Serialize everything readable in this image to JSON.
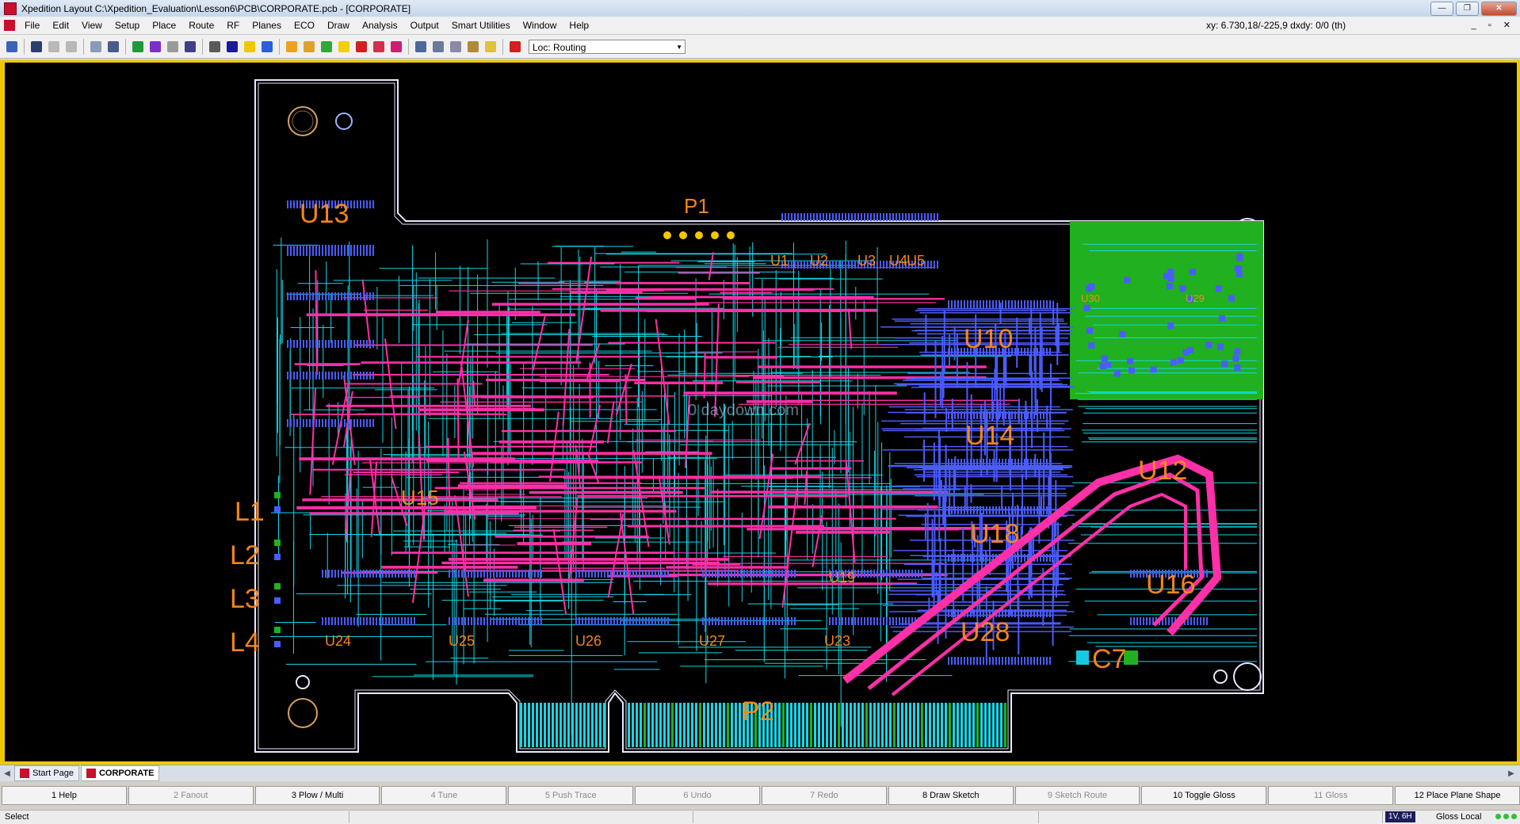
{
  "window": {
    "title": "Xpedition Layout  C:\\Xpedition_Evaluation\\Lesson6\\PCB\\CORPORATE.pcb - [CORPORATE]",
    "buttons": {
      "minimize": "—",
      "restore": "❐",
      "close": "✕"
    }
  },
  "menubar": {
    "items": [
      "File",
      "Edit",
      "View",
      "Setup",
      "Place",
      "Route",
      "RF",
      "Planes",
      "ECO",
      "Draw",
      "Analysis",
      "Output",
      "Smart Utilities",
      "Window",
      "Help"
    ],
    "coordinates": "xy: 6.730,18/-225,9  dxdy: 0/0  (th)",
    "mdi_buttons": "_ ▫ ✕"
  },
  "toolbar": {
    "loc_select": "Loc: Routing",
    "icons": [
      "save-icon",
      "find-icon",
      "undo-icon",
      "redo-icon",
      "place-icon",
      "move-icon",
      "select-area-icon",
      "cross-probe-icon",
      "highlight-icon",
      "mirror-icon",
      "pointer-icon",
      "layer-icon",
      "route-icon",
      "gloss-icon",
      "display-icon",
      "fanout-icon",
      "tune-icon",
      "drc-icon",
      "drc-check-icon",
      "spf-icon",
      "design-check-icon",
      "zoom-icon",
      "zoom-area-icon",
      "zoom-fit-icon",
      "view-icon",
      "netline-icon",
      "grid-icon"
    ]
  },
  "board": {
    "refdes": [
      "P1",
      "P2",
      "U13",
      "U10",
      "U14",
      "U18",
      "U28",
      "U12",
      "U16",
      "L1",
      "L2",
      "L3",
      "L4",
      "U24",
      "U25",
      "U26",
      "U27",
      "U23",
      "U19",
      "U15",
      "U30",
      "U29",
      "C7",
      "U1",
      "U2",
      "U3",
      "U4",
      "U5"
    ],
    "watermark": "0 daydown.com"
  },
  "tabs": {
    "items": [
      "Start Page",
      "CORPORATE"
    ],
    "active": "CORPORATE"
  },
  "fkeys": [
    {
      "label": "1 Help",
      "enabled": true
    },
    {
      "label": "2 Fanout",
      "enabled": false
    },
    {
      "label": "3 Plow / Multi",
      "enabled": true
    },
    {
      "label": "4 Tune",
      "enabled": false
    },
    {
      "label": "5 Push Trace",
      "enabled": false
    },
    {
      "label": "6 Undo",
      "enabled": false
    },
    {
      "label": "7 Redo",
      "enabled": false
    },
    {
      "label": "8 Draw Sketch",
      "enabled": true
    },
    {
      "label": "9 Sketch Route",
      "enabled": false
    },
    {
      "label": "10 Toggle Gloss",
      "enabled": true
    },
    {
      "label": "11 Gloss",
      "enabled": false
    },
    {
      "label": "12 Place Plane Shape",
      "enabled": true
    }
  ],
  "status": {
    "mode": "Select",
    "layer": "1V, 6H",
    "gloss": "Gloss Local"
  },
  "colors": {
    "canvas_bg": "#000000",
    "board_outline": "#e8e8ff",
    "trace_cyan": "#12d8e8",
    "trace_magenta": "#ff2fa8",
    "trace_blue": "#4a5cff",
    "plane_green": "#20b020",
    "refdes_orange": "#ff8c1a",
    "frame_yellow": "#f0c800"
  }
}
